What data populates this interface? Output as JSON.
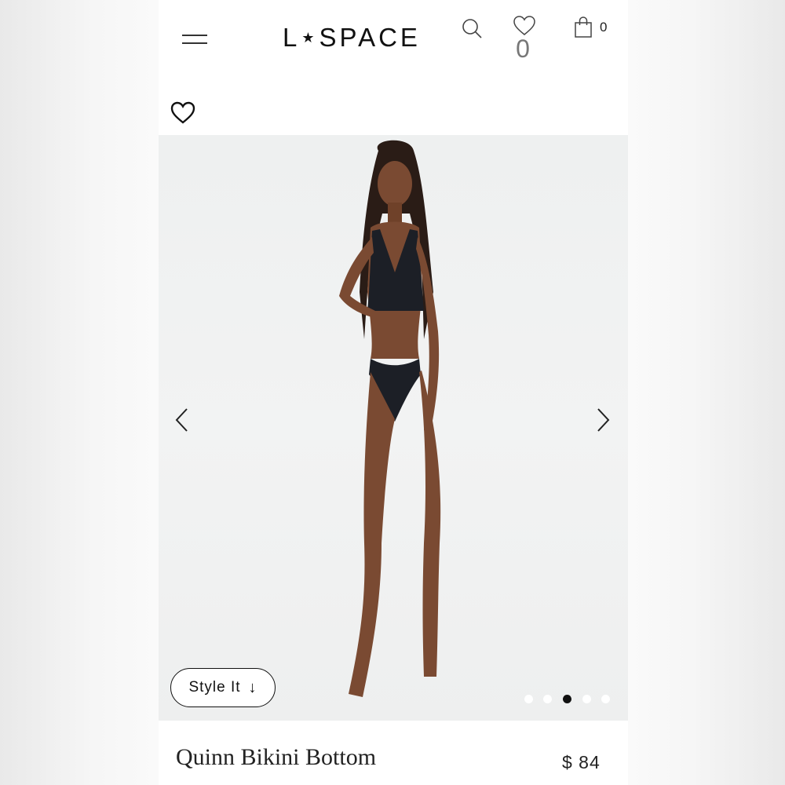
{
  "header": {
    "logo_text_left": "L",
    "logo_star": "★",
    "logo_text_right": "SPACE",
    "wishlist_count": "0",
    "bag_count": "0",
    "icons": [
      "menu-icon",
      "search-icon",
      "heart-icon",
      "shopping-bag-icon"
    ]
  },
  "gallery": {
    "favorite_icon": "heart-outline-icon",
    "prev_icon": "chevron-left-icon",
    "next_icon": "chevron-right-icon",
    "style_it_label": "Style It",
    "style_it_arrow": "↓",
    "slide_count": 5,
    "active_slide": 3
  },
  "product": {
    "name": "Quinn Bikini Bottom",
    "price": "$ 84"
  },
  "colors": {
    "text": "#111111",
    "inactive_dot": "#ffffff",
    "active_dot": "#111111",
    "swimsuit": "#1c1f26"
  }
}
